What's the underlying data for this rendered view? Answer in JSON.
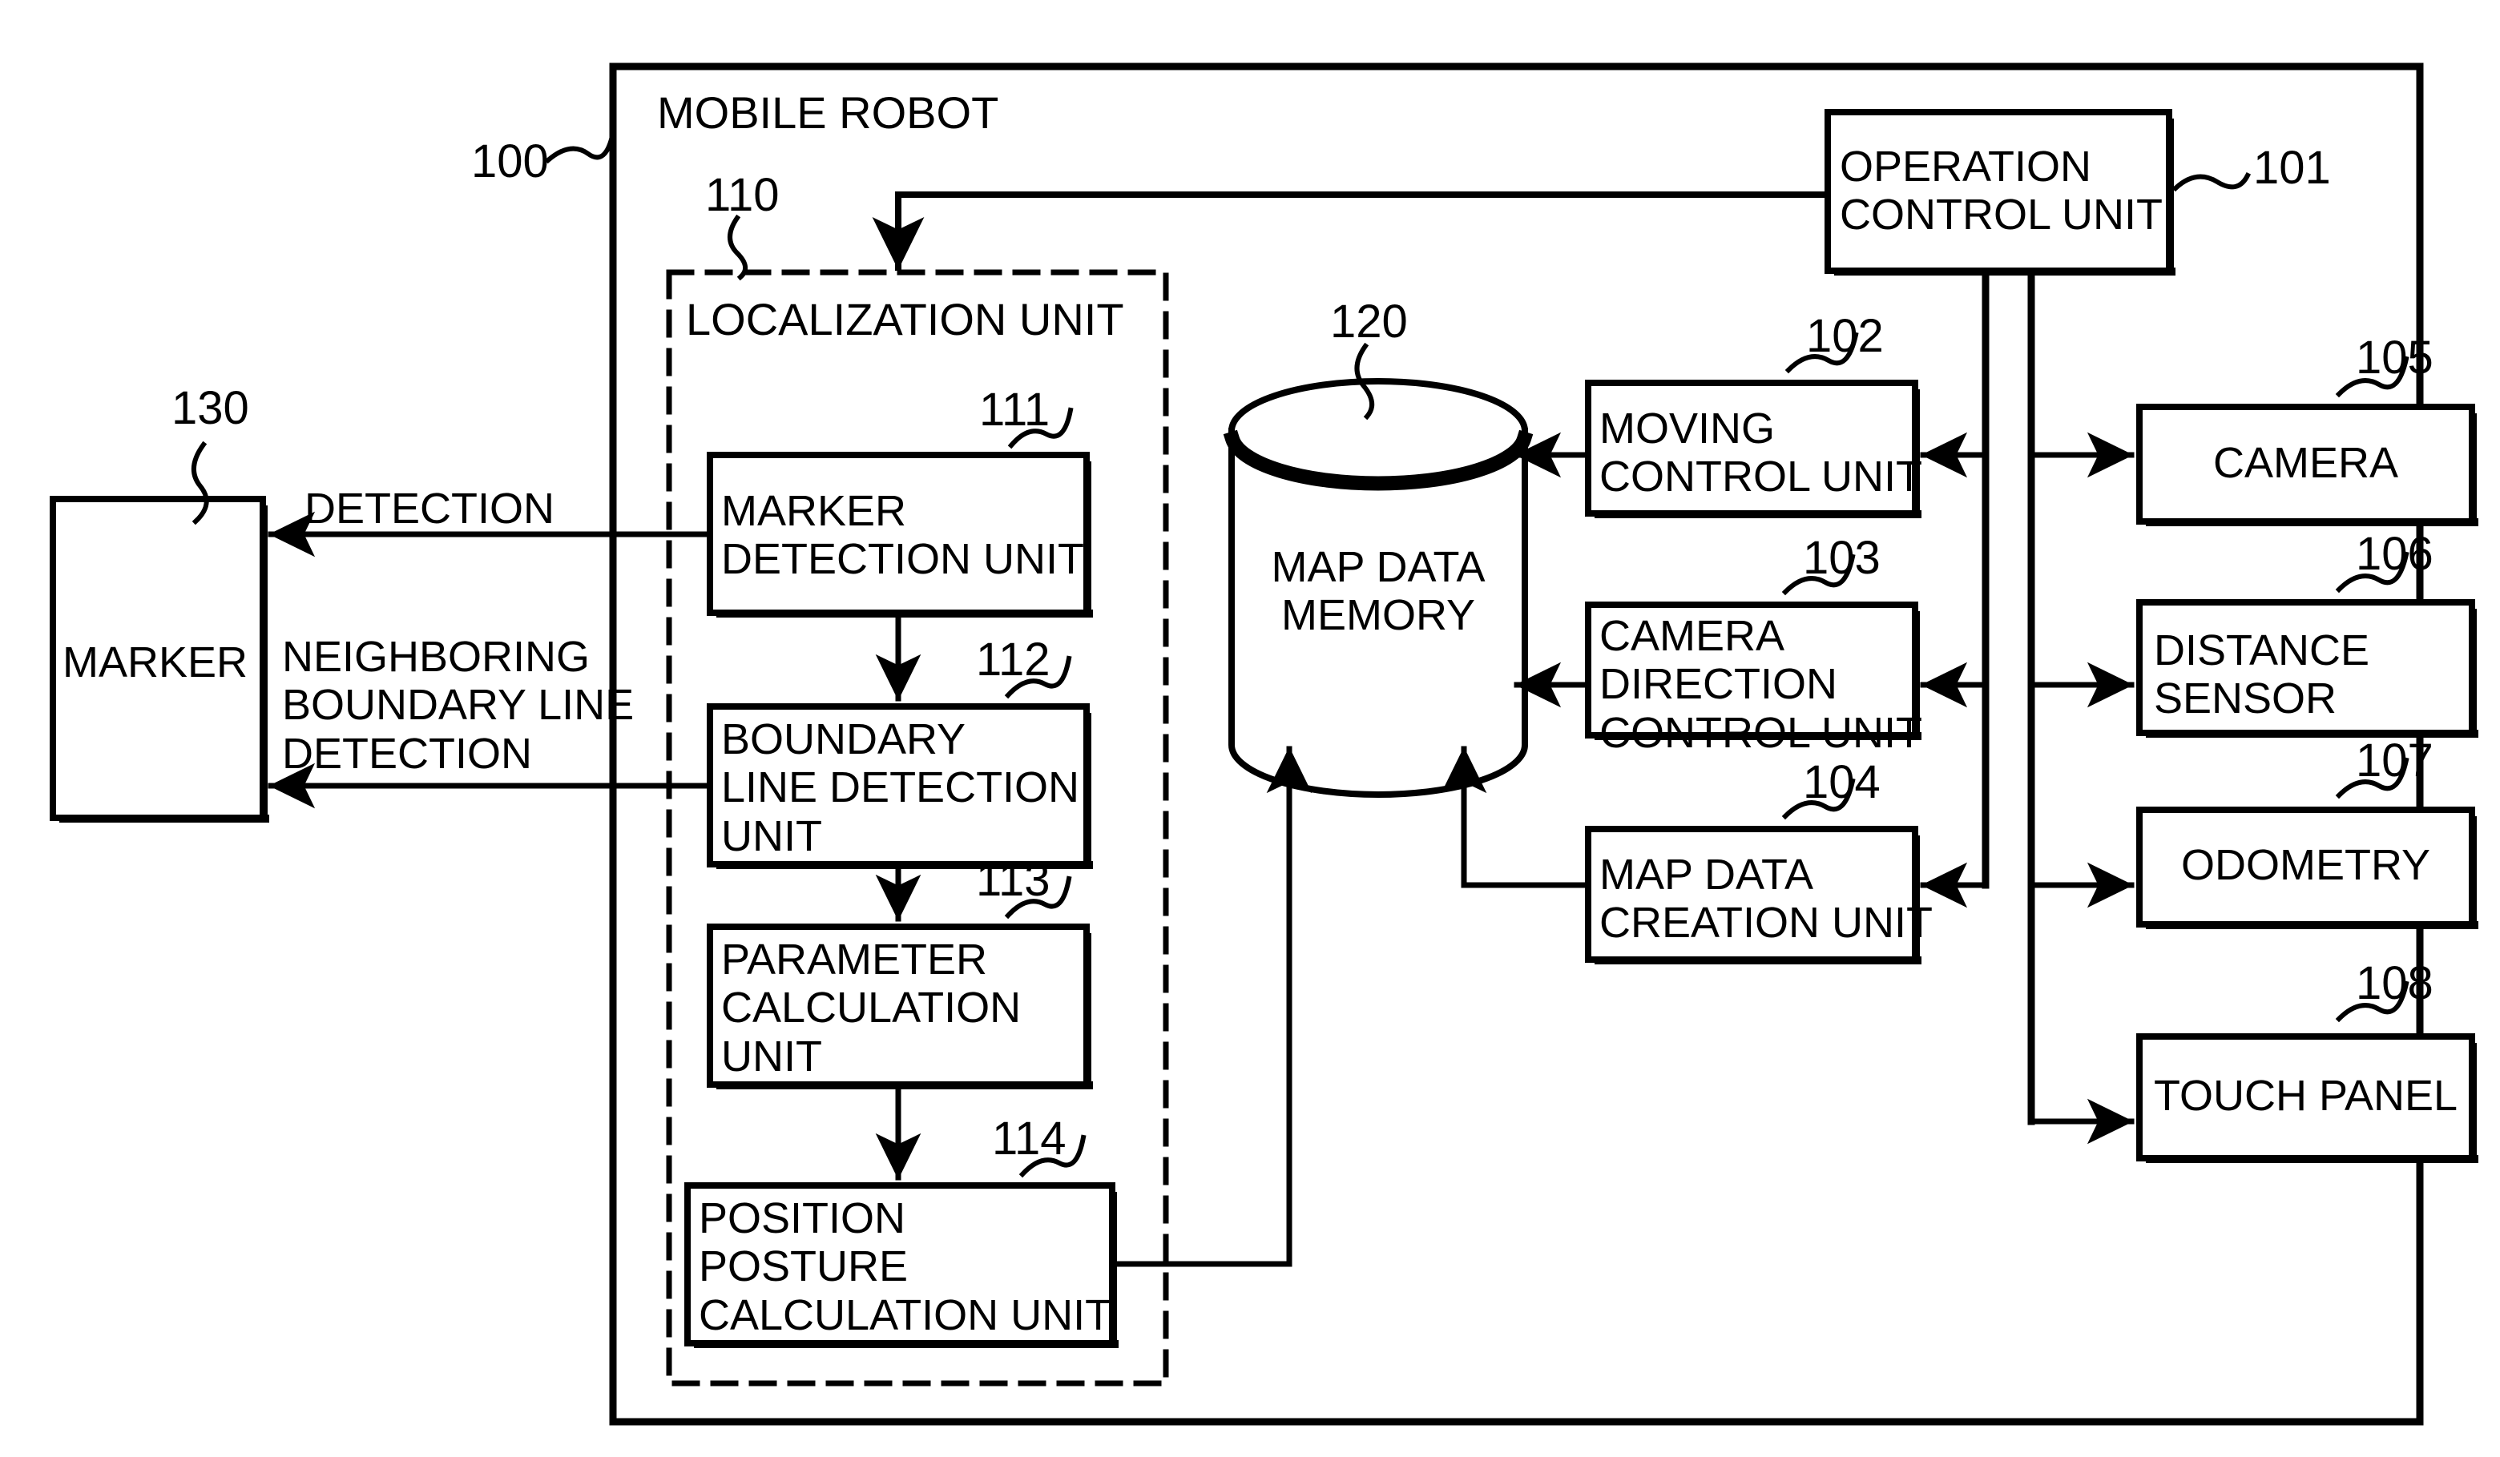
{
  "diagram": {
    "title": "MOBILE ROBOT",
    "outer_ref": "100",
    "colors": {
      "stroke": "#000000",
      "fill": "#ffffff",
      "background": "#ffffff"
    }
  },
  "localization": {
    "title": "LOCALIZATION UNIT",
    "ref": "110",
    "units": [
      {
        "ref": "111",
        "label": "MARKER\nDETECTION UNIT"
      },
      {
        "ref": "112",
        "label": "BOUNDARY\nLINE DETECTION\nUNIT"
      },
      {
        "ref": "113",
        "label": "PARAMETER\nCALCULATION\nUNIT"
      },
      {
        "ref": "114",
        "label": "POSITION\nPOSTURE\nCALCULATION UNIT"
      }
    ]
  },
  "marker": {
    "ref": "130",
    "label": "MARKER",
    "signal_detection": "DETECTION",
    "signal_boundary": "NEIGHBORING\nBOUNDARY LINE\nDETECTION"
  },
  "memory": {
    "ref": "120",
    "label": "MAP DATA\nMEMORY"
  },
  "control_units": [
    {
      "ref": "101",
      "label": "OPERATION\nCONTROL UNIT"
    },
    {
      "ref": "102",
      "label": "MOVING\nCONTROL UNIT"
    },
    {
      "ref": "103",
      "label": "CAMERA\nDIRECTION\nCONTROL UNIT"
    },
    {
      "ref": "104",
      "label": "MAP DATA\nCREATION UNIT"
    }
  ],
  "devices": [
    {
      "ref": "105",
      "label": "CAMERA"
    },
    {
      "ref": "106",
      "label": "DISTANCE\nSENSOR"
    },
    {
      "ref": "107",
      "label": "ODOMETRY"
    },
    {
      "ref": "108",
      "label": "TOUCH PANEL"
    }
  ]
}
